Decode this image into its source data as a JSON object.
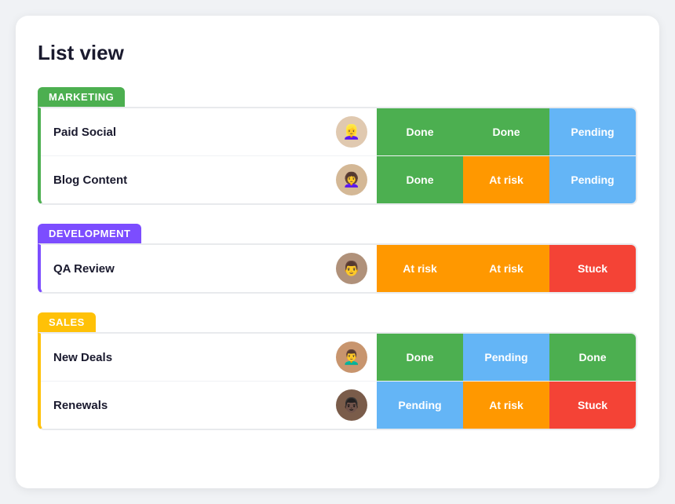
{
  "page": {
    "title": "List view"
  },
  "groups": [
    {
      "id": "marketing",
      "label": "MARKETING",
      "colorClass": "group-marketing",
      "rows": [
        {
          "name": "Paid Social",
          "avatarClass": "avatar-1",
          "avatarEmoji": "👱‍♀️",
          "statuses": [
            {
              "label": "Done",
              "class": "status-done"
            },
            {
              "label": "Done",
              "class": "status-done"
            },
            {
              "label": "Pending",
              "class": "status-pending"
            }
          ]
        },
        {
          "name": "Blog Content",
          "avatarClass": "avatar-2",
          "avatarEmoji": "👩‍🦱",
          "statuses": [
            {
              "label": "Done",
              "class": "status-done"
            },
            {
              "label": "At risk",
              "class": "status-at-risk"
            },
            {
              "label": "Pending",
              "class": "status-pending"
            }
          ]
        }
      ]
    },
    {
      "id": "development",
      "label": "DEVELOPMENT",
      "colorClass": "group-development",
      "rows": [
        {
          "name": "QA Review",
          "avatarClass": "avatar-3",
          "avatarEmoji": "👨",
          "statuses": [
            {
              "label": "At risk",
              "class": "status-at-risk"
            },
            {
              "label": "At risk",
              "class": "status-at-risk"
            },
            {
              "label": "Stuck",
              "class": "status-stuck"
            }
          ]
        }
      ]
    },
    {
      "id": "sales",
      "label": "SALES",
      "colorClass": "group-sales",
      "rows": [
        {
          "name": "New Deals",
          "avatarClass": "avatar-4",
          "avatarEmoji": "👨‍🦱",
          "statuses": [
            {
              "label": "Done",
              "class": "status-done"
            },
            {
              "label": "Pending",
              "class": "status-pending"
            },
            {
              "label": "Done",
              "class": "status-done"
            }
          ]
        },
        {
          "name": "Renewals",
          "avatarClass": "avatar-5",
          "avatarEmoji": "👨🏿",
          "statuses": [
            {
              "label": "Pending",
              "class": "status-pending"
            },
            {
              "label": "At risk",
              "class": "status-at-risk"
            },
            {
              "label": "Stuck",
              "class": "status-stuck"
            }
          ]
        }
      ]
    }
  ]
}
